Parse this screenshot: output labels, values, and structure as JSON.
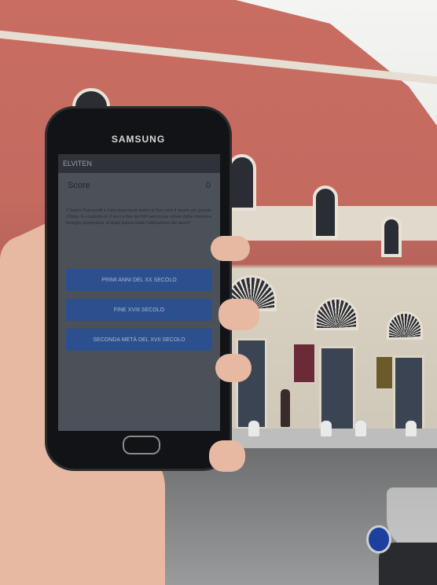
{
  "phone": {
    "brand": "SAMSUNG",
    "status_left": "ELVITEN",
    "app": {
      "score_label": "Score",
      "score_value": "0",
      "question": "Il Teatro Petruzzelli è il più importante teatro di Bari ed è il quarto più grande d'Italia. Fu costruito in 3 anni a fine del XIX secolo per volere della omonima famiglia proprietaria. A quale epoca risale l'ultimazione dei lavori?",
      "answers": [
        "PRIMI ANNI DEL XX SECOLO",
        "FINE XVIII SECOLO",
        "SECONDA METÀ DEL XVII SECOLO"
      ]
    }
  },
  "colors": {
    "screen_bg": "#4c5058",
    "answer_button": "#2c4f8e",
    "facade": "#c96d62"
  }
}
